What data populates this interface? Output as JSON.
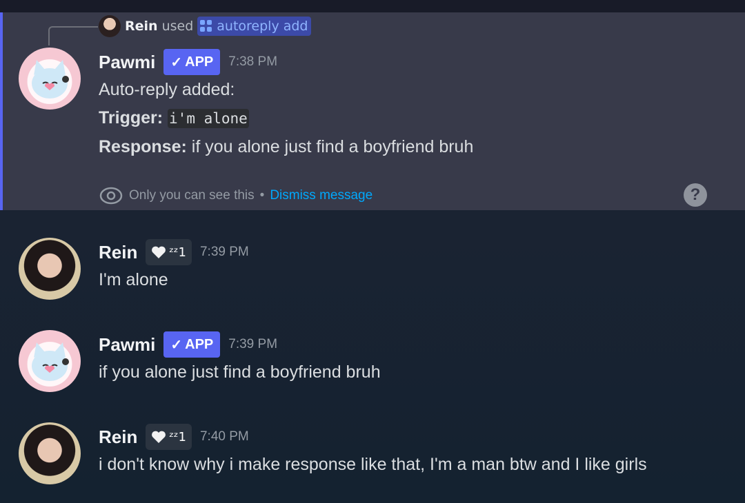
{
  "command_invocation": {
    "user": "Rein",
    "used_text": "used",
    "command": "autoreply add"
  },
  "ephemeral_message": {
    "author": "Pawmi",
    "badge": "APP",
    "timestamp": "7:38 PM",
    "line1": "Auto-reply added:",
    "trigger_label": "Trigger:",
    "trigger_value": "i'm alone",
    "response_label": "Response:",
    "response_value": "if you alone just find a boyfriend bruh",
    "footer_text": "Only you can see this",
    "footer_sep": "•",
    "dismiss_label": "Dismiss message",
    "help_label": "?"
  },
  "messages": [
    {
      "author": "Rein",
      "status_text": "ᶻᶻ1",
      "timestamp": "7:39 PM",
      "content": "I'm alone"
    },
    {
      "author": "Pawmi",
      "badge": "APP",
      "timestamp": "7:39 PM",
      "content": "if you alone just find a boyfriend bruh"
    },
    {
      "author": "Rein",
      "status_text": "ᶻᶻ1",
      "timestamp": "7:40 PM",
      "content": "i don't know why i make response like that, I'm a man btw and I like girls"
    }
  ],
  "colors": {
    "accent": "#5865f2",
    "link": "#00a8fc",
    "ephemeral_bg": "#383a4a"
  }
}
